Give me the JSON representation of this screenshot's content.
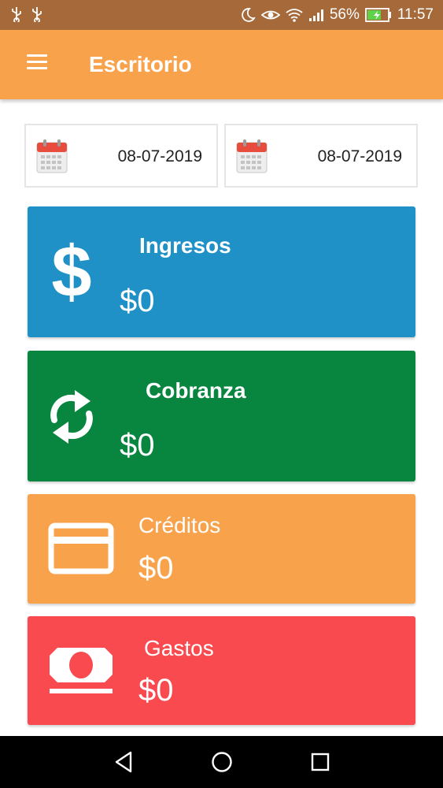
{
  "status_bar": {
    "battery": "56%",
    "time": "11:57",
    "icons": [
      "usb-icon",
      "usb-icon",
      "moon-icon",
      "eye-icon",
      "wifi-icon",
      "signal-icon",
      "battery-charging-icon"
    ]
  },
  "app_bar": {
    "title": "Escritorio",
    "menu_icon": "hamburger-menu-icon"
  },
  "date_range": {
    "start": "08-07-2019",
    "end": "08-07-2019",
    "icon": "calendar-icon"
  },
  "cards": [
    {
      "title": "Ingresos",
      "value": "$0",
      "icon": "dollar-icon",
      "color": "#1f91c6"
    },
    {
      "title": "Cobranza",
      "value": "$0",
      "icon": "refresh-icon",
      "color": "#08853f"
    },
    {
      "title": "Créditos",
      "value": "$0",
      "icon": "credit-card-icon",
      "color": "#f9a24c"
    },
    {
      "title": "Gastos",
      "value": "$0",
      "icon": "money-bill-icon",
      "color": "#f94a4f"
    }
  ],
  "nav_bar": {
    "buttons": [
      "back-icon",
      "home-icon",
      "recents-icon"
    ]
  },
  "colors": {
    "status_bar": "#a5693a",
    "app_bar": "#f9a24c",
    "nav_bar": "#000000"
  }
}
